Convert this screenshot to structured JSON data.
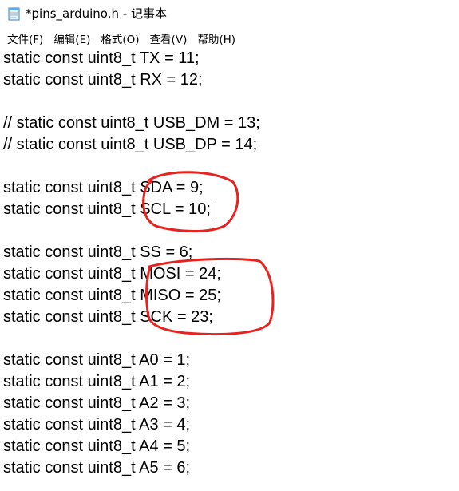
{
  "window": {
    "title": "*pins_arduino.h - 记事本"
  },
  "menu": {
    "items": [
      "文件(F)",
      "编辑(E)",
      "格式(O)",
      "查看(V)",
      "帮助(H)"
    ]
  },
  "editor": {
    "lines": [
      "static const uint8_t TX = 11;",
      "static const uint8_t RX = 12;",
      "",
      "// static const uint8_t USB_DM = 13;",
      "// static const uint8_t USB_DP = 14;",
      "",
      "static const uint8_t SDA = 9;",
      "static const uint8_t SCL = 10;",
      "",
      "static const uint8_t SS = 6;",
      "static const uint8_t MOSI = 24;",
      "static const uint8_t MISO = 25;",
      "static const uint8_t SCK = 23;",
      "",
      "static const uint8_t A0 = 1;",
      "static const uint8_t A1 = 2;",
      "static const uint8_t A2 = 3;",
      "static const uint8_t A3 = 4;",
      "static const uint8_t A4 = 5;",
      "static const uint8_t A5 = 6;"
    ]
  },
  "icons": {
    "app": "notepad-icon"
  },
  "colors": {
    "annotation": "#e8231f",
    "text": "#000000",
    "background": "#ffffff"
  }
}
